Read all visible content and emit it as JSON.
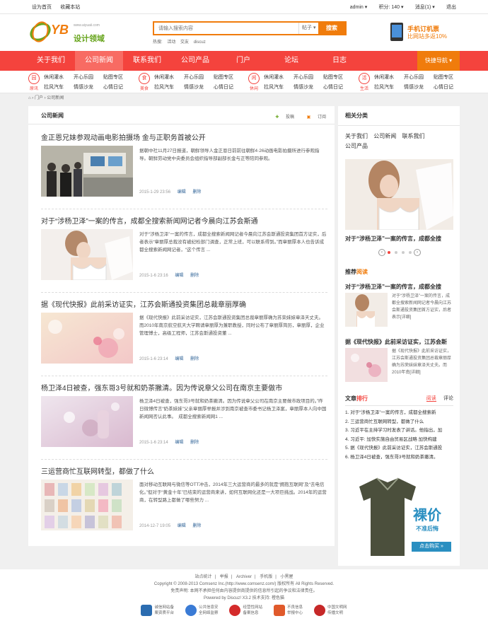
{
  "topbar": {
    "home": "设为首页",
    "fav": "收藏本站",
    "user": "admin ▾",
    "points": "积分: 140 ▾",
    "msg": "消息(1) ▾",
    "logout": "退出"
  },
  "header": {
    "logo_text": "YB",
    "logo_sub": "设计领域",
    "logo_url": "www.aiyuaii.com",
    "search_placeholder": "请输入搜索内容",
    "search_select": "帖子 ▾",
    "search_button": "搜索",
    "hot_label": "热搜:",
    "hot_words": [
      "活动",
      "交友",
      "discuz"
    ],
    "phone_line1": "手机订机票",
    "phone_line2": "比网站多返10%"
  },
  "nav": {
    "items": [
      "关于我们",
      "公司新闻",
      "联系我们",
      "公司产品",
      "门户",
      "论坛",
      "日志"
    ],
    "quick": "快捷导航 ▾"
  },
  "subnav": {
    "groups": [
      {
        "icon": "园",
        "label": "原讯",
        "links": [
          "休闲灌水",
          "开心乐园",
          "贴图专区",
          "拉风汽车",
          "情感沙龙",
          "心情日记"
        ]
      },
      {
        "icon": "食",
        "label": "美食",
        "links": [
          "休闲灌水",
          "开心乐园",
          "贴图专区",
          "拉风汽车",
          "情感沙龙",
          "心情日记"
        ]
      },
      {
        "icon": "闲",
        "label": "休闲",
        "links": [
          "休闲灌水",
          "开心乐园",
          "贴图专区",
          "拉风汽车",
          "情感沙龙",
          "心情日记"
        ]
      },
      {
        "icon": "活",
        "label": "生活",
        "links": [
          "休闲灌水",
          "开心乐园",
          "贴图专区",
          "拉风汽车",
          "情感沙龙",
          "心情日记"
        ]
      }
    ]
  },
  "breadcrumb": "⌂ › 门户 › 公司新闻",
  "main": {
    "title": "公司新闻",
    "submit": "投稿",
    "subscribe": "订阅",
    "articles": [
      {
        "title": "金正恩兄妹参观动画电影拍摄场 金与正职务首被公开",
        "summary": "据朝中社11月27日报道，朝鲜领导人金正恩日前前往朝鲜4·26动画电影拍摄所进行参观指导。朝鲜劳动党中央委员会组织指导部副部长金与正等陪同参观。",
        "date": "2015-1-29 23:56",
        "edit": "编辑",
        "del": "删除"
      },
      {
        "title": "对于“涉杨卫泽”一案的传言，成都全搜索新闻网记者今晨向江苏会斯通",
        "summary": "对于“涉杨卫泽”一案的传言，成都全搜索新闻网记者今晨向江苏会斯通投资集团首方证实，后者表示“章丽厚总裁没有被纪检部门调查，正常上班，可以联系得到。”而章丽厚本人也告诉成都全搜索新闻网记者，“这个传言 ...",
        "date": "2015-1-6 23:16",
        "edit": "编辑",
        "del": "删除"
      },
      {
        "title": "据《现代快报》此前采访证实，江苏会斯通投资集团总裁章丽厚确",
        "summary": "据《现代快报》此前采访证实，江苏会斯通投资集团总裁章丽厚确为苏荣妹妹章泽天丈夫。而2010年南京航空航天大学聘请章丽厚为兼职教授，同时公布了章丽厚简历，章丽厚，企业管理博士，高级工程师，江苏会斯通投资董 ...",
        "date": "2015-1-6 23:14",
        "edit": "编辑",
        "del": "删除"
      },
      {
        "title": "杨卫泽4日被查，强东哥3号就和奶茶撇清。因为传说章父公司在南京主要做市",
        "summary": "杨卫泽4日被查，强东哥3号就和奶茶撇清。因为传说章父公司在南京主要做市政项目的。”昨日微博传言“奶茶妹妹”父亲章丽厚举报并涉到南京被查市委书记杨卫泽案，章丽厚本人向中国新闻网否认此事。　成都全搜索新闻网1 ...",
        "date": "2015-1-6 23:14",
        "edit": "编辑",
        "del": "删除"
      },
      {
        "title": "三运营商忙互联网转型，都做了什么",
        "summary": "面对移动互联网与微信等OTT冲击，2014年三大运营商的最多的就是“拥抱互联网”及“去电信化。”但对于“黄金十年”已结束的运营商来讲，如何互联网化还是一大项巨挑战。2014年的运营商，在转型路上都做了哪些努力 ...",
        "date": "2014-12-7 19:05",
        "edit": "编辑",
        "del": "删除"
      }
    ]
  },
  "side": {
    "related_title": "相关分类",
    "categories": [
      "关于我们",
      "公司新闻",
      "联系我们",
      "公司产品"
    ],
    "slide_caption": "对于“涉杨卫泽”一案的传言，成都全搜",
    "rec_title_a": "推荐",
    "rec_title_b": "阅读",
    "recs": [
      {
        "title": "对于“涉杨卫泽”一案的传言，成都全搜",
        "summary": "对于“涉杨卫泽”一案的传言，成都全搜索新闻网记者今晨向江苏会斯通投资集团首方证实，后者表示[详细]"
      },
      {
        "title": "据《现代快报》此前采访证实，江苏会斯",
        "summary": "据《现代快报》此前采访证实，江苏会斯通投资集团总裁章丽厚确为苏荣妹妹章泽天丈夫。而2010年南[详细]"
      }
    ],
    "rank_title_a": "文章",
    "rank_title_b": "排行",
    "rank_tab1": "阅读",
    "rank_tab2": "评论",
    "rank_items": [
      "1. 对于“涉杨卫泽”一案的传言，成都全搜索新",
      "2. 三运营商忙互联网转型，都做了什么",
      "3. 习近平在主持学习时发表了讲话。他指出，加",
      "4. 习近平: 加快实施自由贸易区战略 加快构建",
      "5. 据《现代快报》此前采访证实，江苏会斯通投",
      "6. 杨卫泽4日被查，强东哥3号就和奶茶撇清。"
    ],
    "ad_main": "裸价",
    "ad_sub": "不准后悔",
    "ad_btn": "点击购买 »"
  },
  "footer": {
    "links": [
      "站点统计",
      "举报",
      "Archiver",
      "手机版",
      "小黑屋"
    ],
    "copyright": "Copyright © 2008-2013 Comsenz Inc.(http://www.comsenz.com/) 版权所有 All Rights Reserved.",
    "disclaimer": "免责声明: 本网不承担任何由内容提供商提供的信息所引起的争议和法律责任。",
    "powered": "Powered by Discuz! X3.2  技术支持: 橙色猫",
    "badges": [
      {
        "l1": "诚信网站备",
        "l2": "案资质平台"
      },
      {
        "l1": "公共信息安",
        "l2": "全网络监察"
      },
      {
        "l1": "经营性网站",
        "l2": "备案信息"
      },
      {
        "l1": "不良信息",
        "l2": "举报中心"
      },
      {
        "l1": "中国文明网",
        "l2": "传播文明"
      }
    ]
  }
}
